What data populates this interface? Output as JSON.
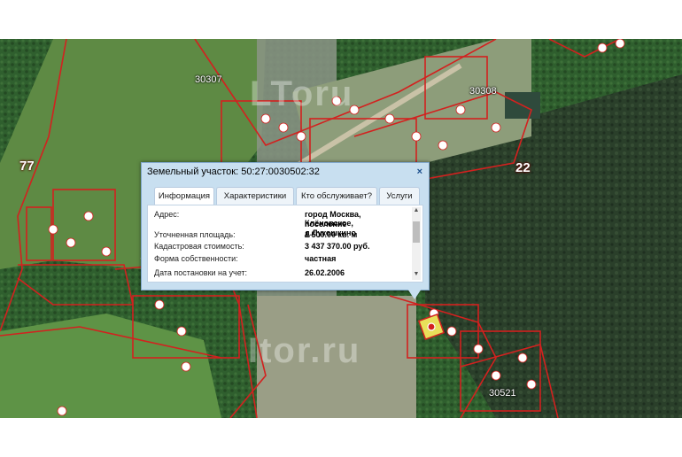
{
  "map": {
    "labels": {
      "block_30307": "30307",
      "block_30308": "30308",
      "block_30521": "30521",
      "district_77": "77",
      "district_22": "22"
    },
    "watermark_top": "LToru",
    "watermark_bottom": "Itor.ru",
    "colors": {
      "forest": "#2e5a2c",
      "field": "#6b8f4a",
      "boundary": "#c81e1e",
      "highlight": "#e8e05a"
    }
  },
  "popup": {
    "title": "Земельный участок: 50:27:0030502:32",
    "close_symbol": "×",
    "tabs": [
      {
        "label": "Информация",
        "active": true
      },
      {
        "label": "Характеристики",
        "active": false
      },
      {
        "label": "Кто обслуживает?",
        "active": false
      },
      {
        "label": "Услуги",
        "active": false
      }
    ],
    "rows": [
      {
        "label": "Адрес:",
        "value": "город Москва, поселение"
      },
      {
        "label": "",
        "value": "Клёновское, д.Лукошкино"
      },
      {
        "label": "Уточненная площадь:",
        "value": "1 500.00 кв. м"
      },
      {
        "label": "Кадастровая стоимость:",
        "value": "3 437 370.00 руб."
      },
      {
        "label": "Форма собственности:",
        "value": "частная"
      },
      {
        "label": "Дата постановки на учет:",
        "value": "26.02.2006"
      }
    ]
  }
}
